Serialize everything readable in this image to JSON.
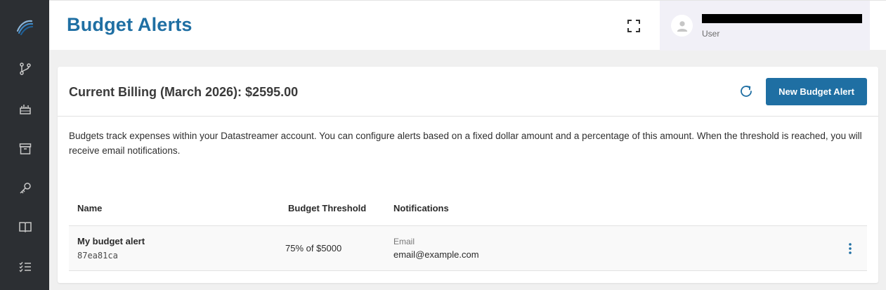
{
  "header": {
    "title": "Budget Alerts",
    "fullscreen_icon": "fullscreen-icon",
    "user": {
      "role": "User",
      "avatar_icon": "user-avatar-icon"
    }
  },
  "sidebar": {
    "logo_icon": "datastreamer-logo-icon",
    "items": [
      {
        "icon": "pipeline-branch-icon"
      },
      {
        "icon": "analytics-chart-icon"
      },
      {
        "icon": "archive-box-icon"
      },
      {
        "icon": "key-icon"
      },
      {
        "icon": "book-icon"
      },
      {
        "icon": "checklist-icon"
      }
    ]
  },
  "card": {
    "billing_title": "Current Billing (March 2026): $2595.00",
    "refresh_icon": "refresh-icon",
    "new_alert_label": "New Budget Alert",
    "description": "Budgets track expenses within your Datastreamer account. You can configure alerts based on a fixed dollar amount and a percentage of this amount. When the threshold is reached, you will receive email notifications."
  },
  "table": {
    "columns": [
      "Name",
      "Budget Threshold",
      "Notifications"
    ],
    "rows": [
      {
        "name": "My budget alert",
        "id": "87ea81ca",
        "threshold": "75% of $5000",
        "notification_type": "Email",
        "notification_email": "email@example.com"
      }
    ]
  },
  "colors": {
    "sidebar_bg": "#2c2f33",
    "accent": "#1f6fa3",
    "user_panel_bg": "#f1f0f7",
    "page_bg": "#f0f0f0"
  }
}
